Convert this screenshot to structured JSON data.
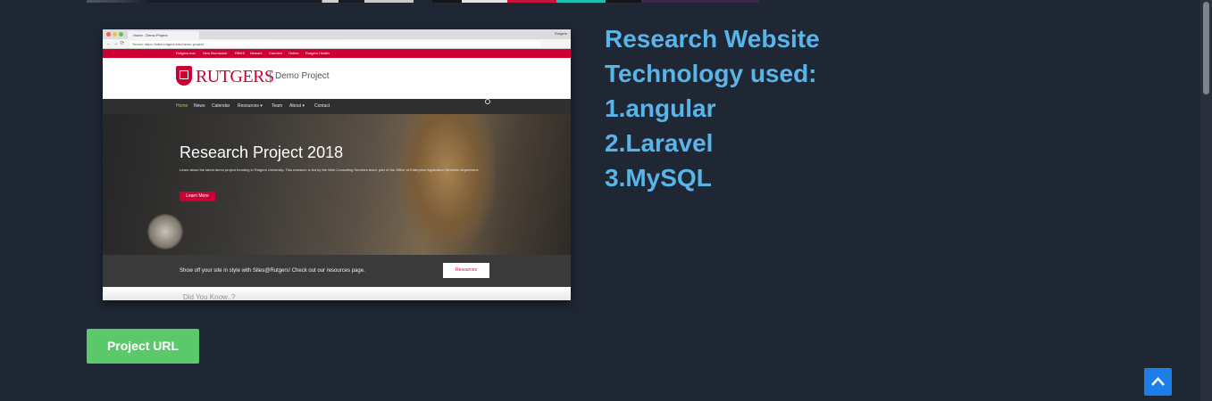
{
  "colors": {
    "page_bg": "#1f2735",
    "heading": "#59b5e8",
    "button_green": "#5bc96b",
    "back_to_top": "#1c7fe8",
    "rutgers_red": "#cc0033"
  },
  "screenshot": {
    "browser_tab": "Home - Demo Project",
    "window_label": "Rutgers",
    "url_secure": "Secure",
    "url": "https://sites.rutgers.edu/demo-project",
    "top_links": [
      "Rutgers.edu",
      "New Brunswick",
      "RBHS",
      "Newark",
      "Camden",
      "Online",
      "Rutgers Health"
    ],
    "logo_text": "RUTGERS",
    "site_name": "Demo Project",
    "nav": [
      "Home",
      "News",
      "Calendar",
      "Resources ▾",
      "Team",
      "About ▾",
      "Contact"
    ],
    "hero_title": "Research Project 2018",
    "hero_desc": "Learn about the latest demo project trending in Rutgers University. This research is led by the Web Consulting Services team, part of the Office of Enterprise Application Services department.",
    "hero_button": "Learn More",
    "resource_text": "Show off your site in style with Sites@Rutgers! Check out our resources page.",
    "resource_button": "Resources",
    "below_fold": "Did You Know..?"
  },
  "description": {
    "lines": [
      "Research Website",
      "Technology used:",
      "1.angular",
      "2.Laravel",
      "3.MySQL"
    ]
  },
  "project_button": "Project URL",
  "back_to_top_icon": "chevron-up-icon"
}
